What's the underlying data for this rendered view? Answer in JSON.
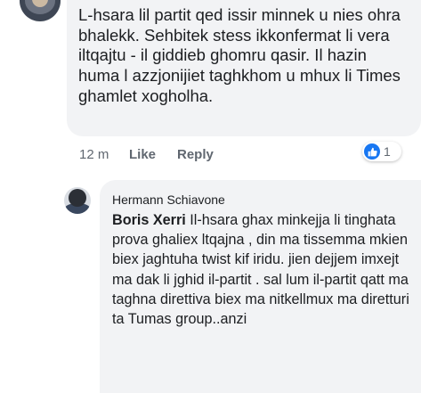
{
  "comment": {
    "text": "L-hsara lil partit qed issir minnek u nies ohra bhalekk. Sehbitek stess ikkonfermat li vera iltqajtu - il giddieb ghomru qasir. Il hazin huma l azzjonijiet taghkhom u mhux li Times ghamlet xogholha.",
    "time": "12 m",
    "like_label": "Like",
    "reply_label": "Reply",
    "reaction_count": "1",
    "reaction_icon": "like-icon",
    "reaction_color": "#1877f2"
  },
  "reply": {
    "author": "Hermann Schiavone",
    "mention": "Boris Xerri",
    "text": " Il-hsara ghax minkejja li tinghata prova ghaliex ltqajna , din ma tissemma mkien biex jaghtuha twist kif iridu. jien dejjem imxejt ma dak li jghid il-partit . sal lum il-partit qatt ma taghna direttiva biex ma nitkellmux ma diretturi ta Tumas group..anzi"
  }
}
